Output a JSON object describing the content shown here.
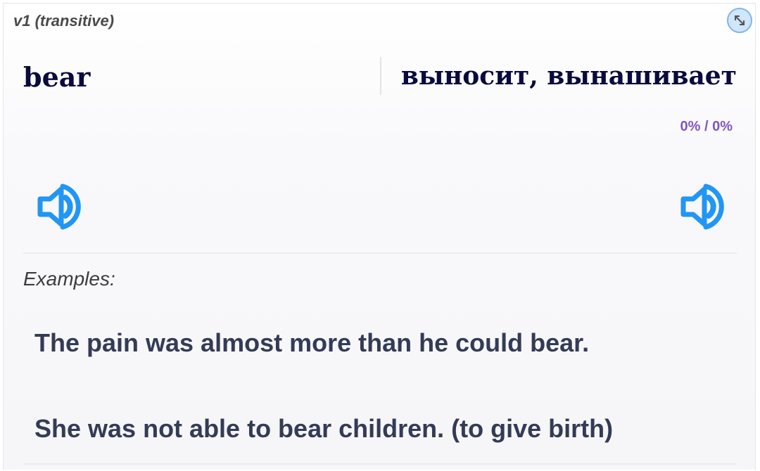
{
  "header": {
    "part_of_speech": "v1 (transitive)",
    "expand_icon": "expand-arrows-icon"
  },
  "card": {
    "word": "bear",
    "translation": "выносит, вынашивает",
    "progress": "0% / 0%",
    "speaker_icon": "speaker-icon"
  },
  "examples": {
    "label": "Examples:",
    "items": [
      "The pain was almost more than he could bear.",
      "She was not able to bear children. (to give birth)"
    ]
  },
  "colors": {
    "accent_blue": "#2196f3",
    "progress_purple": "#7e57c2",
    "word_navy": "#0a0a3c",
    "example_text": "#343b55"
  }
}
